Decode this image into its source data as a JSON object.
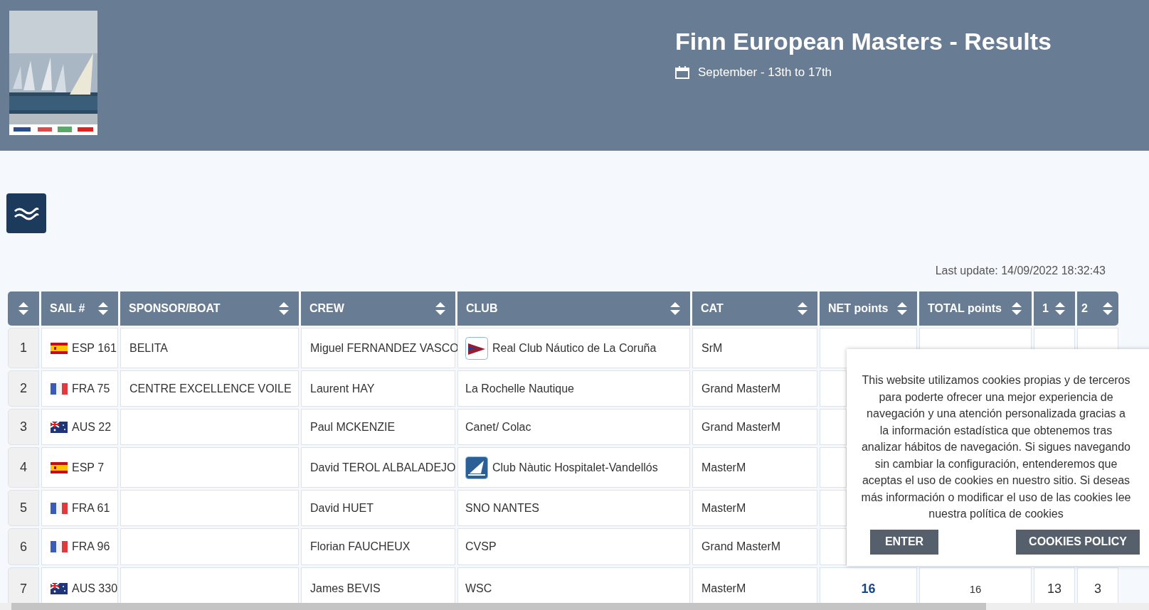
{
  "header": {
    "title": "Finn European Masters - Results",
    "dates": "September - 13th to 17th"
  },
  "last_update": "Last update: 14/09/2022 18:32:43",
  "table": {
    "columns": [
      {},
      {
        "label": "SAIL #"
      },
      {
        "label": "SPONSOR/BOAT"
      },
      {
        "label": "CREW"
      },
      {
        "label": "CLUB"
      },
      {
        "label": "CAT"
      },
      {
        "label": "NET points"
      },
      {
        "label": "TOTAL points"
      },
      {
        "label": "1"
      },
      {
        "label": "2"
      }
    ],
    "rows": [
      {
        "rank": "1",
        "sail": {
          "text": "ESP 161",
          "kind": "spain"
        },
        "boat": "BELITA",
        "crew": "Miguel FERNANDEZ VASCO",
        "club": {
          "text": "Real Club Náutico de La Coruña",
          "kind": "pennant"
        },
        "cat": "SrM"
      },
      {
        "rank": "2",
        "sail": {
          "text": "FRA 75",
          "kind": "france"
        },
        "boat": "CENTRE EXCELLENCE VOILE",
        "crew": "Laurent HAY",
        "club": {
          "text": "La Rochelle Nautique"
        },
        "cat": "Grand MasterM"
      },
      {
        "rank": "3",
        "sail": {
          "text": "AUS 22",
          "kind": "australia"
        },
        "crew": "Paul MCKENZIE",
        "club": {
          "text": "Canet/ Colac"
        },
        "cat": "Grand MasterM"
      },
      {
        "rank": "4",
        "sail": {
          "text": "ESP 7",
          "kind": "spain"
        },
        "crew": "David TEROL ALBALADEJO",
        "club": {
          "text": "Club Nàutic Hospitalet-Vandellós",
          "kind": "sail"
        },
        "cat": "MasterM"
      },
      {
        "rank": "5",
        "sail": {
          "text": "FRA 61",
          "kind": "france"
        },
        "crew": "David HUET",
        "club": {
          "text": "SNO NANTES"
        },
        "cat": "MasterM"
      },
      {
        "rank": "6",
        "sail": {
          "text": "FRA 96",
          "kind": "france"
        },
        "crew": "Florian FAUCHEUX",
        "club": {
          "text": "CVSP"
        },
        "cat": "Grand MasterM"
      },
      {
        "rank": "7",
        "sail": {
          "text": "AUS 330",
          "kind": "australia"
        },
        "crew": "James BEVIS",
        "club": {
          "text": "WSC"
        },
        "cat": "MasterM",
        "net": "16",
        "total": "16",
        "r1": "13",
        "r2": "3"
      }
    ]
  },
  "cookie_notice": {
    "text": "This website utilizamos cookies propias y de terceros para poderte ofrecer una mejor experiencia de navegación y una atención personalizada gracias a la información estadística que obtenemos tras analizar hábitos de navegación. Si sigues navegando sin cambiar la configuración, entenderemos que aceptas el uso de cookies en nuestro sitio. Si deseas más información o modificar el uso de las cookies lee nuestra política de cookies",
    "buttons": [
      "ENTER",
      "COOKIES POLICY"
    ]
  }
}
